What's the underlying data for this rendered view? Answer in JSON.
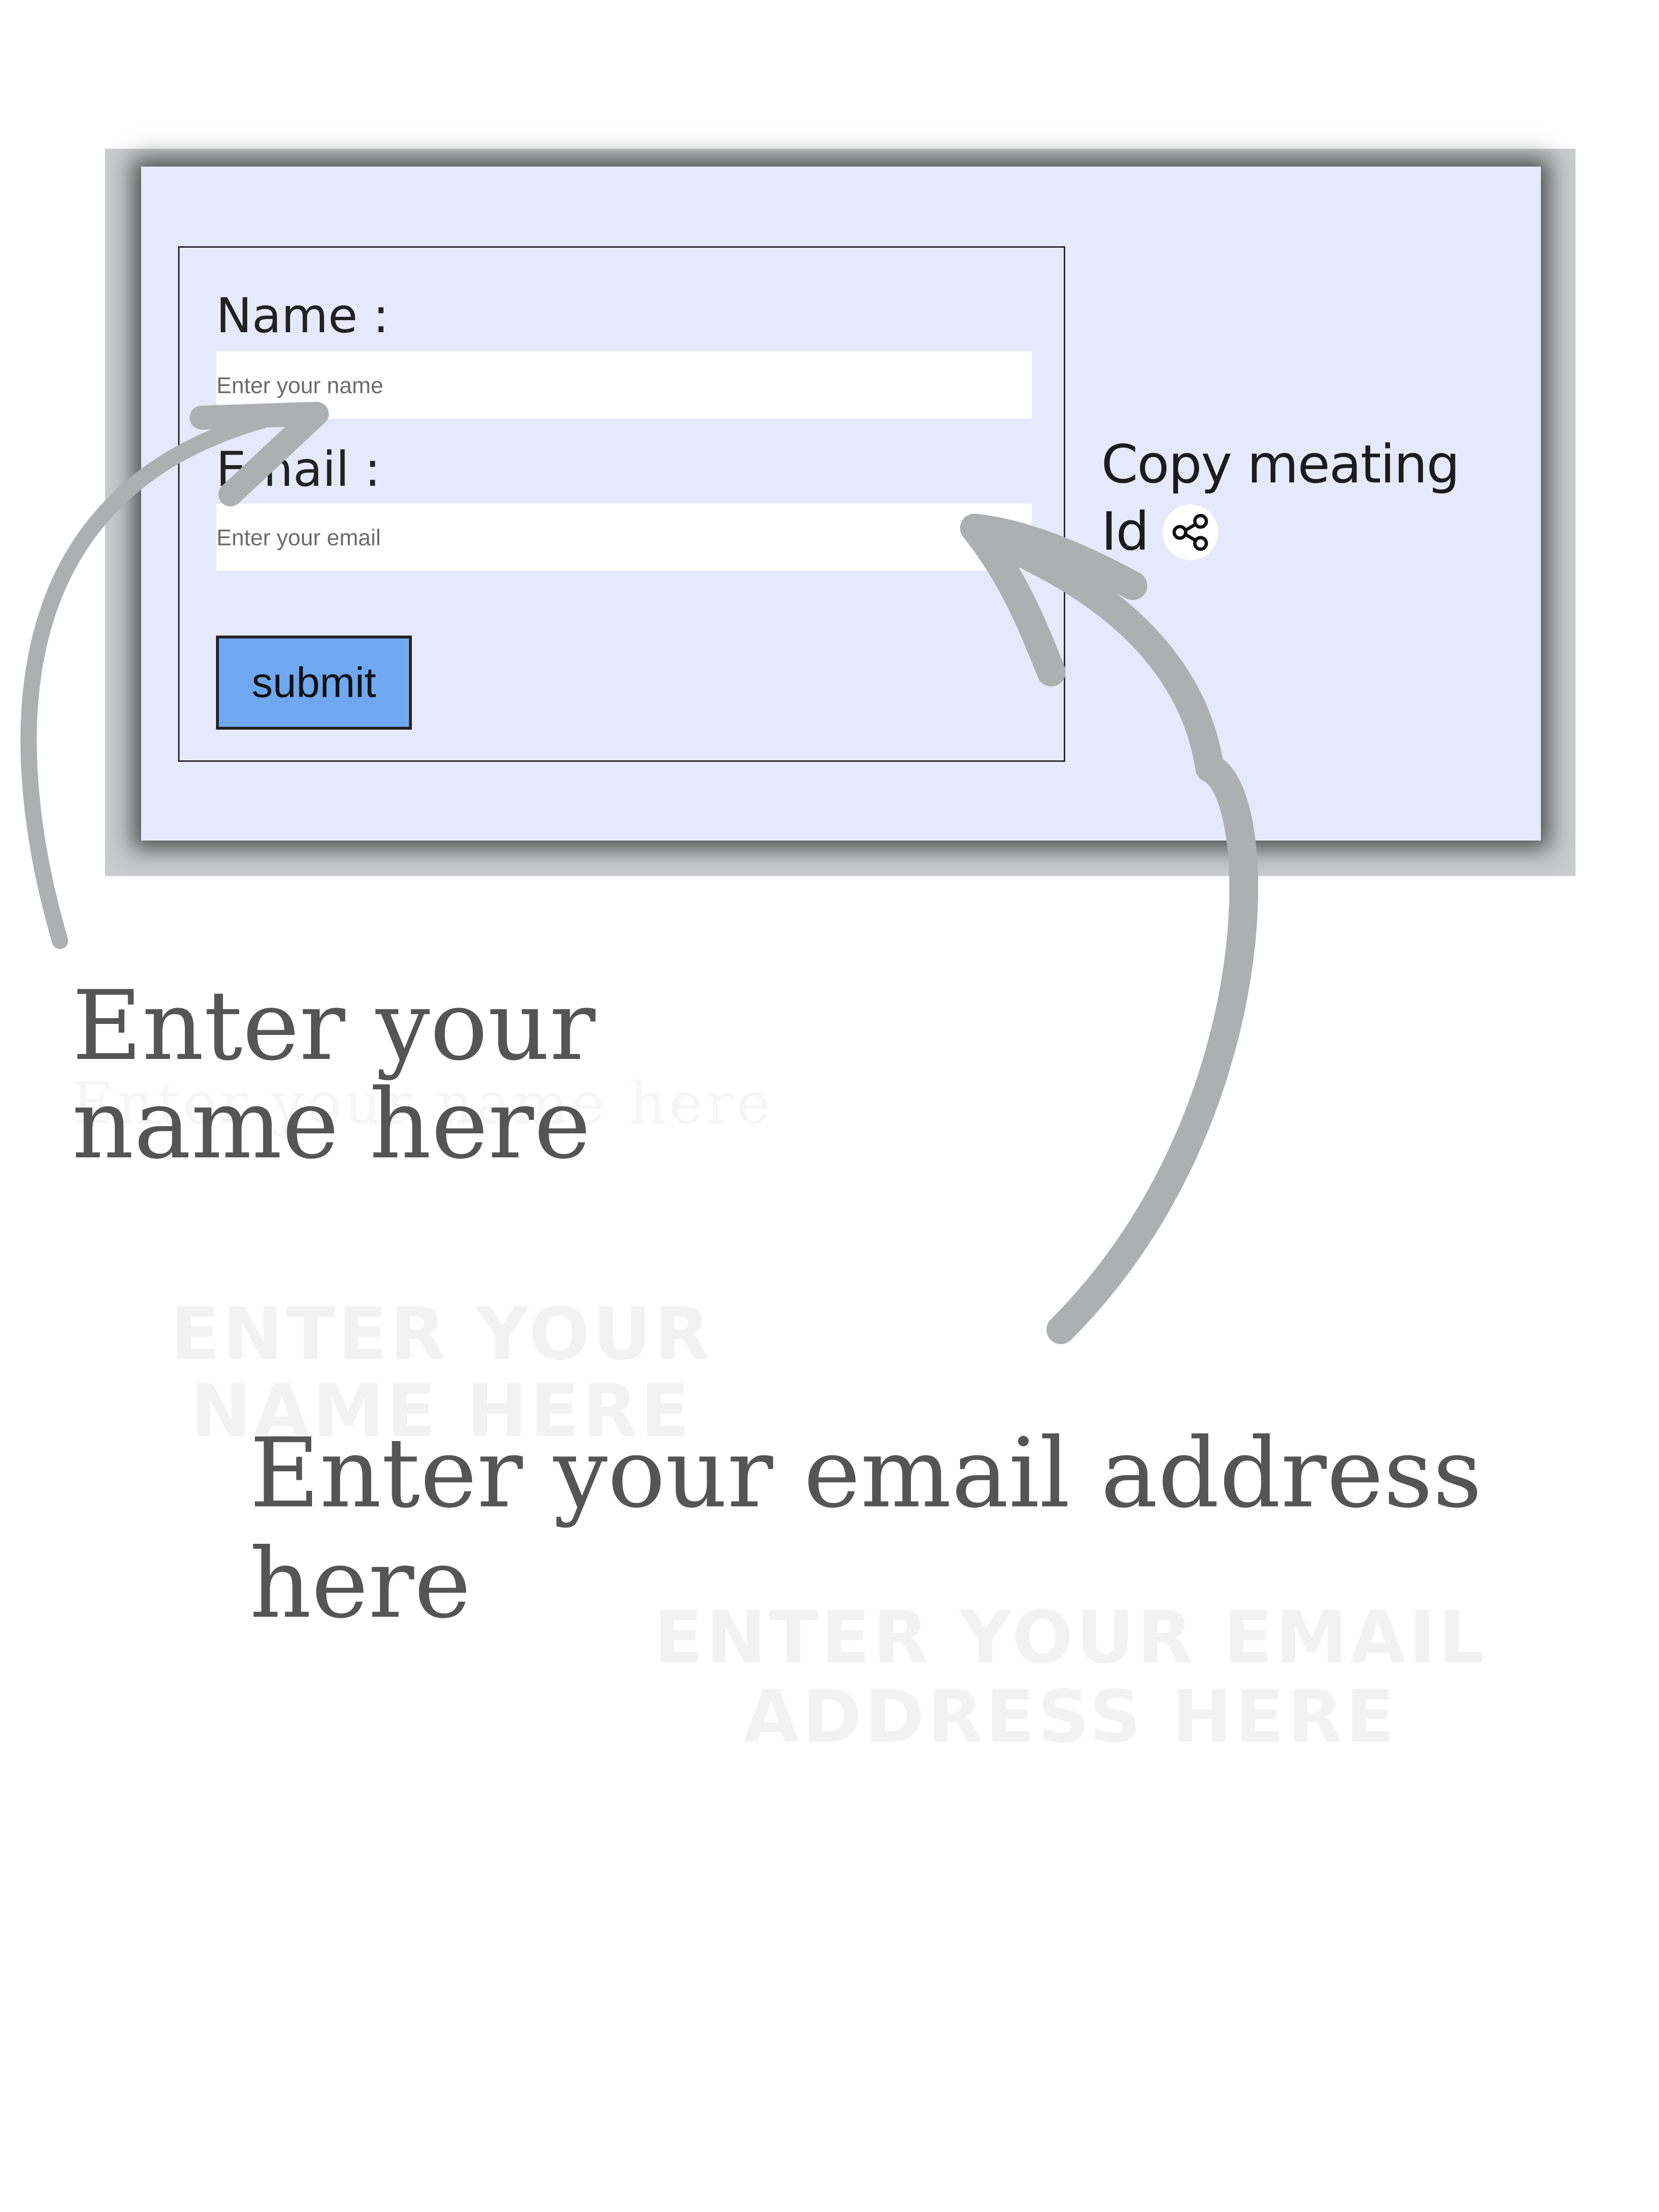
{
  "form": {
    "name_label": "Name :",
    "name_placeholder": "Enter your name",
    "name_value": "",
    "email_label": "Email :",
    "email_placeholder": "Enter your email",
    "email_value": "",
    "submit_label": "submit"
  },
  "copy_meeting": {
    "label": "Copy meating Id",
    "icon": "share-icon"
  },
  "annotations": {
    "name_hint": "Enter your name here",
    "email_hint": "Enter your email address here",
    "arrow_icon": "curved-arrow-icon",
    "ghost_name_caps": "ENTER YOUR NAME HERE",
    "ghost_email_caps": "ENTER YOUR  EMAIL ADDRESS HERE"
  },
  "colors": {
    "card_background": "#e8e8fc",
    "frame_background": "#c9cbcc",
    "submit_button": "#6fa8f0",
    "arrow": "#aeafb1",
    "annotation_text": "#555555"
  }
}
